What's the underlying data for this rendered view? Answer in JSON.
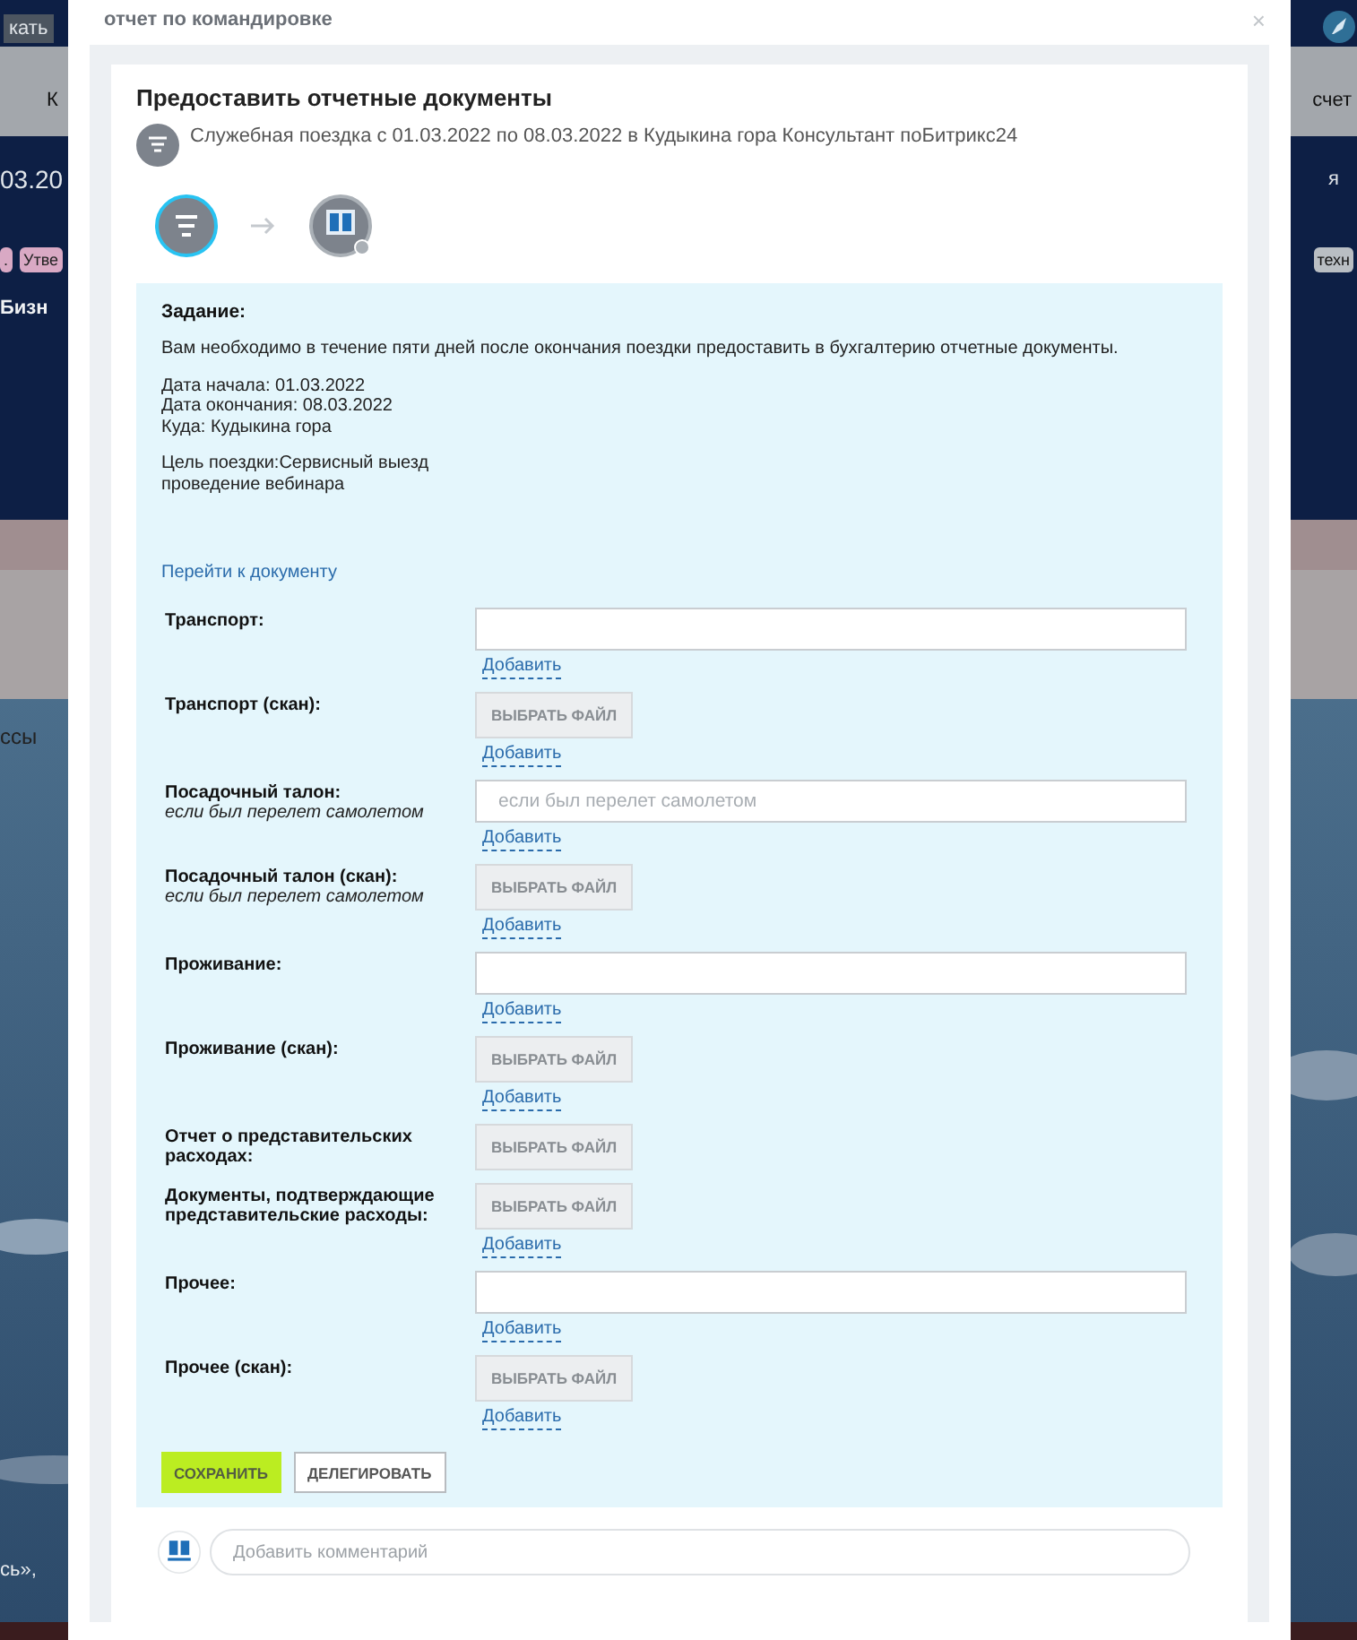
{
  "backdrop": {
    "left_texts": [
      {
        "text": "кать",
        "kind": "field"
      },
      {
        "text": "К",
        "kind": "tab"
      },
      {
        "text": "03.20",
        "kind": "heading"
      },
      {
        "text": ".",
        "kind": "tag"
      },
      {
        "text": "Утве",
        "kind": "tag"
      },
      {
        "text": "Бизн",
        "kind": "link"
      },
      {
        "text": "ссы",
        "kind": "text"
      },
      {
        "text": "сь»,",
        "kind": "footer"
      }
    ],
    "right_texts": [
      {
        "text": "счет",
        "kind": "tab"
      },
      {
        "text": "я",
        "kind": "button"
      },
      {
        "text": "техн",
        "kind": "tag"
      }
    ]
  },
  "window": {
    "title": "отчет по командировке",
    "close": "×"
  },
  "task": {
    "title": "Предоставить отчетные документы",
    "subtitle": "Служебная поездка с 01.03.2022 по 08.03.2022 в Кудыкина гора Консультант поБитрикс24",
    "steps": [
      {
        "kind": "filter",
        "selected": true
      },
      {
        "kind": "logo",
        "selected": false
      }
    ]
  },
  "assignment": {
    "heading": "Задание:",
    "paragraphs": [
      [
        "Вам необходимо в течение пяти дней после окончания поездки предоставить в бухгалтерию отчетные документы."
      ],
      [
        "Дата начала: 01.03.2022",
        "Дата окончания: 08.03.2022",
        "Куда: Кудыкина гора"
      ],
      [
        "Цель поездки:Сервисный выезд",
        "проведение вебинара"
      ]
    ],
    "document_link": "Перейти к документу"
  },
  "fields": [
    {
      "label": "Транспорт:",
      "kind": "text",
      "add": "Добавить"
    },
    {
      "label": "Транспорт (скан):",
      "kind": "file",
      "button": "ВЫБРАТЬ ФАЙЛ",
      "add": "Добавить"
    },
    {
      "label": "Посадочный талон:",
      "hint": "если был перелет самолетом",
      "kind": "text",
      "placeholder": "если был перелет самолетом",
      "add": "Добавить"
    },
    {
      "label": "Посадочный талон (скан):",
      "hint": "если был перелет самолетом",
      "kind": "file",
      "button": "ВЫБРАТЬ ФАЙЛ",
      "add": "Добавить"
    },
    {
      "label": "Проживание:",
      "kind": "text",
      "add": "Добавить"
    },
    {
      "label": "Проживание (скан):",
      "kind": "file",
      "button": "ВЫБРАТЬ ФАЙЛ",
      "add": "Добавить"
    },
    {
      "label": "Отчет о представительских расходах:",
      "kind": "file",
      "button": "ВЫБРАТЬ ФАЙЛ"
    },
    {
      "label": "Документы, подтверждающие представительские расходы:",
      "kind": "file",
      "button": "ВЫБРАТЬ ФАЙЛ",
      "add": "Добавить"
    },
    {
      "label": "Прочее:",
      "kind": "text",
      "add": "Добавить"
    },
    {
      "label": "Прочее (скан):",
      "kind": "file",
      "button": "ВЫБРАТЬ ФАЙЛ",
      "add": "Добавить"
    }
  ],
  "actions": [
    {
      "label": "СОХРАНИТЬ",
      "kind": "primary"
    },
    {
      "label": "ДЕЛЕГИРОВАТЬ",
      "kind": "secondary"
    }
  ],
  "comment": {
    "placeholder": "Добавить комментарий"
  }
}
